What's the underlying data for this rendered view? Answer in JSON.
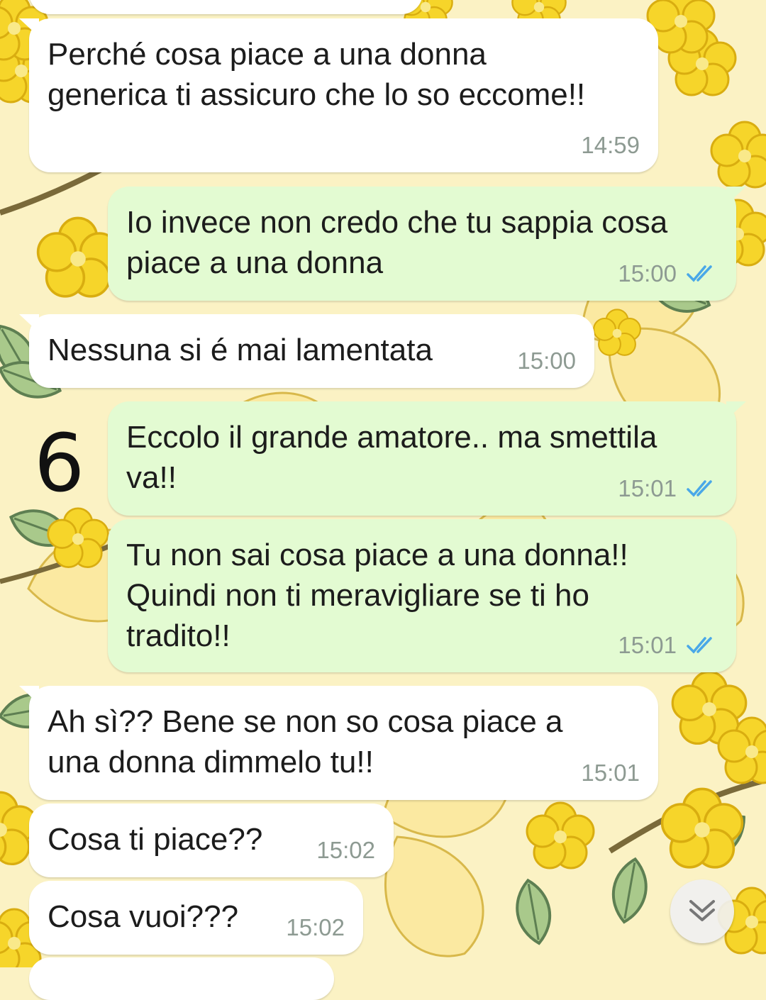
{
  "messages": [
    {
      "direction": "in",
      "text": "Perché cosa piace a una donna\ngenerica ti assicuro che lo so eccome!!",
      "time": "14:59"
    },
    {
      "direction": "out",
      "text": "Io invece non credo che tu sappia cosa\npiace a una donna",
      "time": "15:00",
      "status": "read"
    },
    {
      "direction": "in",
      "text": "Nessuna si é mai lamentata",
      "time": "15:00"
    },
    {
      "direction": "out",
      "text": "Eccolo il grande amatore.. ma smettila\nva!!",
      "time": "15:01",
      "status": "read"
    },
    {
      "direction": "out",
      "text": "Tu non sai cosa piace a una donna!!\nQuindi non ti meravigliare se ti ho\ntradito!!",
      "time": "15:01",
      "status": "read"
    },
    {
      "direction": "in",
      "text": "Ah sì?? Bene se non so cosa piace a\nuna donna dimmelo tu!!",
      "time": "15:01"
    },
    {
      "direction": "in",
      "text": "Cosa ti piace??",
      "time": "15:02"
    },
    {
      "direction": "in",
      "text": "Cosa vuoi???",
      "time": "15:02"
    }
  ],
  "annotation": "6",
  "icons": {
    "read_receipt": "double-check-icon",
    "scroll_down": "chevron-double-down-icon"
  },
  "colors": {
    "incoming": "#ffffff",
    "outgoing": "#e3fbd2",
    "read_tick": "#4aa8e8",
    "wallpaper": "#fbf2c4"
  }
}
